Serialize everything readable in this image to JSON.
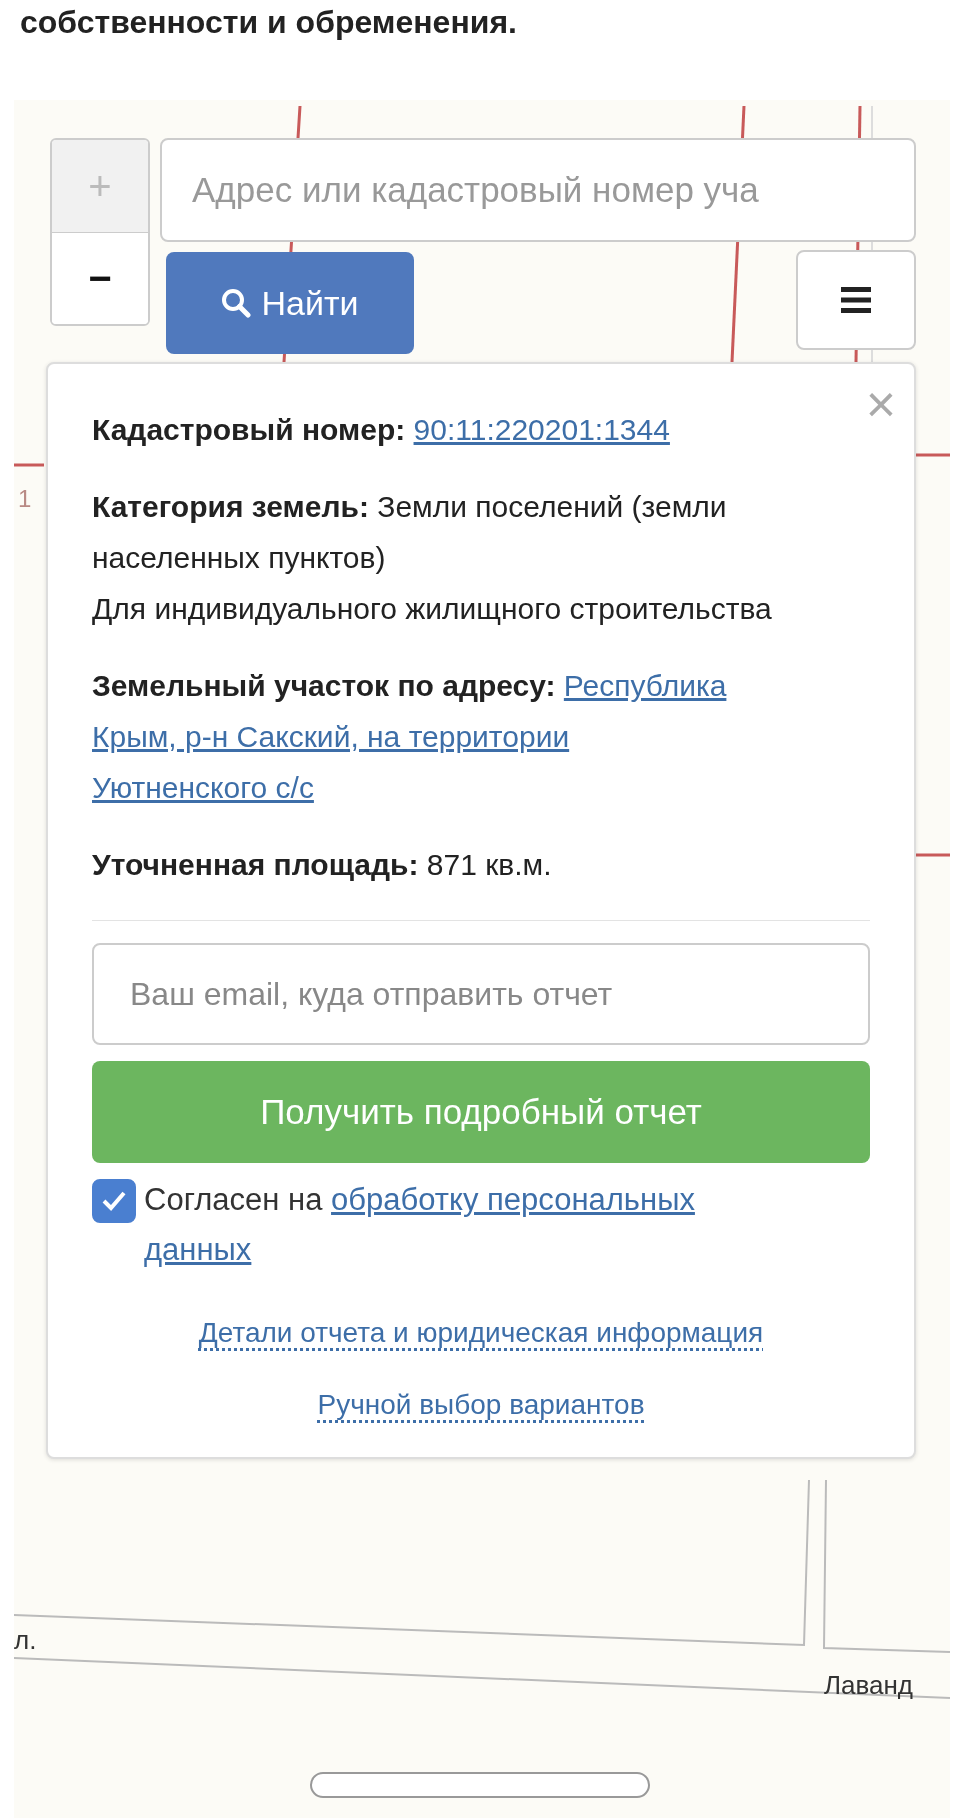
{
  "heading": "собственности и обременения.",
  "map": {
    "labels": [
      {
        "text": "1",
        "kind": "parcel"
      },
      {
        "text": "л.",
        "kind": "street"
      },
      {
        "text": "Лаванд",
        "kind": "street"
      }
    ]
  },
  "zoom": {
    "plus": "+",
    "minus": "−",
    "plus_disabled": true
  },
  "search": {
    "placeholder": "Адрес или кадастровый номер уча",
    "button": "Найти"
  },
  "popup": {
    "close": "×",
    "fields": [
      {
        "label": "Кадастровый номер:",
        "value": "90:11:220201:1344",
        "kind": "link"
      },
      {
        "label": "Категория земель:",
        "value": "Земли поселений (земли населенных пунктов)",
        "kind": "text",
        "note": "Для индивидуального жилищного строительства"
      },
      {
        "label": "Земельный участок по адресу:",
        "value_lines": [
          "Республика",
          "Крым, р-н Сакский, на территории",
          "Уютненского с/с"
        ],
        "kind": "link"
      },
      {
        "label": "Уточненная площадь:",
        "value": "871 кв.м.",
        "kind": "text"
      }
    ],
    "email": {
      "placeholder": "Ваш email, куда отправить отчет"
    },
    "submit": "Получить подробный отчет",
    "consent": {
      "checked": true,
      "text": "Согласен на",
      "link_lines": [
        "обработку персональных",
        "данных"
      ]
    },
    "links": [
      "Детали отчета и юридическая информация",
      "Ручной выбор вариантов"
    ]
  }
}
